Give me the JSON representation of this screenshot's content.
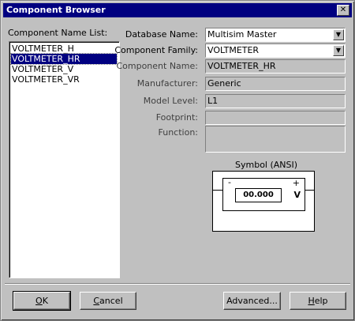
{
  "window": {
    "title": "Component Browser",
    "close_symbol": "✕"
  },
  "list": {
    "label": "Component Name List:",
    "items": [
      "VOLTMETER_H",
      "VOLTMETER_HR",
      "VOLTMETER_V",
      "VOLTMETER_VR"
    ],
    "selected_index": 1
  },
  "fields": {
    "database_name": {
      "label": "Database Name:",
      "value": "Multisim Master"
    },
    "component_family": {
      "label": "Component Family:",
      "value": "VOLTMETER"
    },
    "component_name": {
      "label": "Component Name:",
      "value": "VOLTMETER_HR"
    },
    "manufacturer": {
      "label": "Manufacturer:",
      "value": "Generic"
    },
    "model_level": {
      "label": "Model Level:",
      "value": "L1"
    },
    "footprint": {
      "label": "Footprint:",
      "value": ""
    },
    "function": {
      "label": "Function:",
      "value": ""
    }
  },
  "symbol": {
    "title": "Symbol (ANSI)",
    "display": "00.000",
    "minus": "-",
    "plus": "+",
    "unit": "V"
  },
  "buttons": {
    "ok": {
      "accel": "O",
      "rest": "K"
    },
    "cancel": {
      "accel": "C",
      "rest": "ancel"
    },
    "advanced": "Advanced...",
    "help": {
      "accel": "H",
      "rest": "elp"
    }
  },
  "icons": {
    "close": "close-icon",
    "dropdown": "chevron-down-icon"
  }
}
